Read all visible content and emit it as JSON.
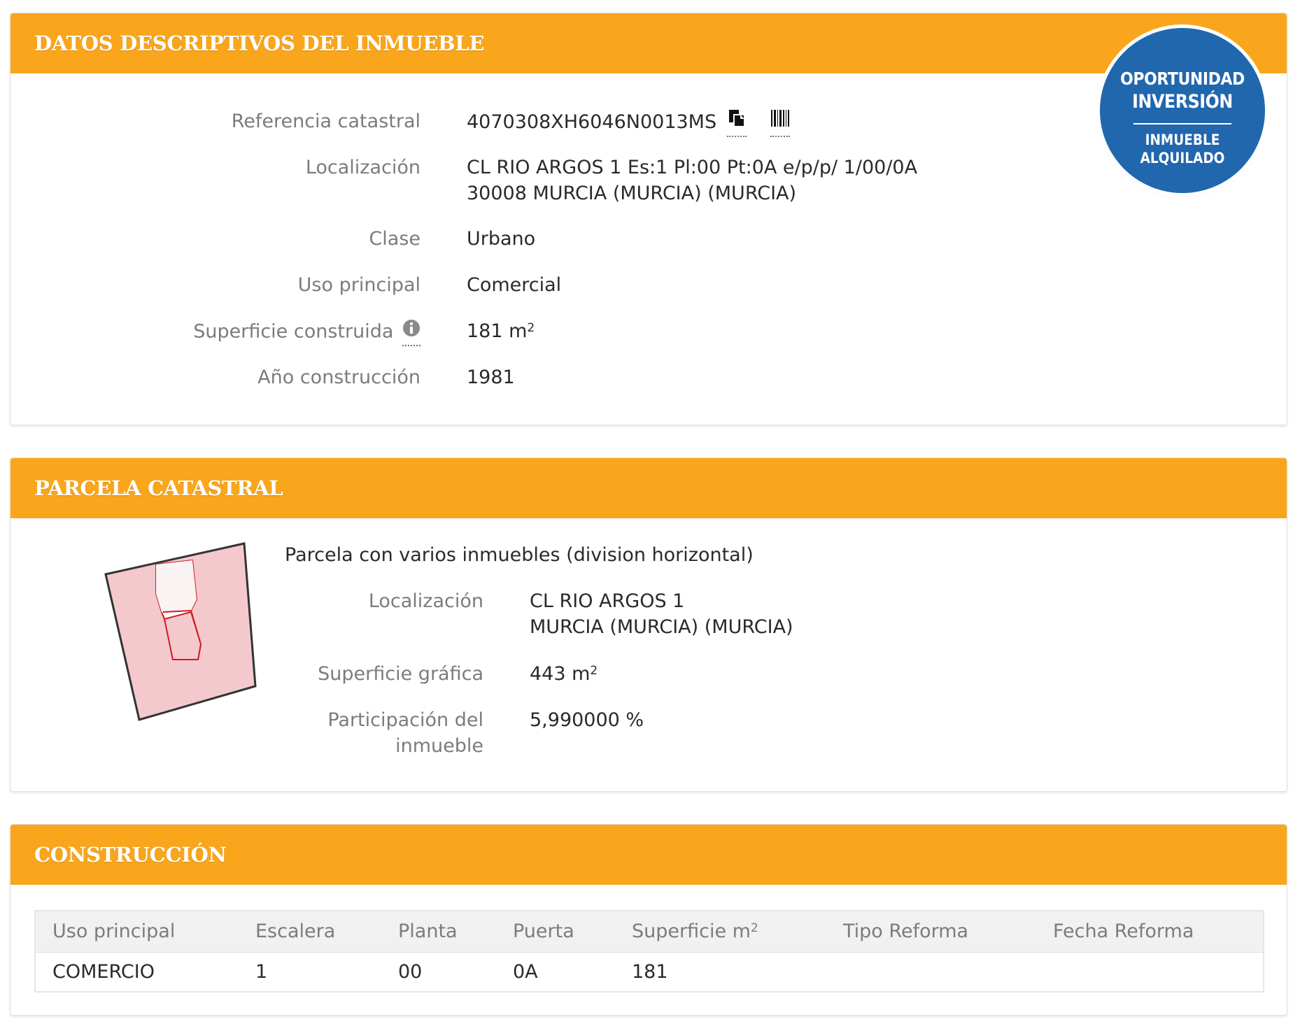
{
  "badge": {
    "line1": "OPORTUNIDAD",
    "line2": "INVERSIÓN",
    "line3": "INMUEBLE",
    "line4": "ALQUILADO",
    "color": "#2167ad"
  },
  "colors": {
    "header": "#f9a61c"
  },
  "datos": {
    "title": "DATOS DESCRIPTIVOS DEL INMUEBLE",
    "referencia_label": "Referencia catastral",
    "referencia_value": "4070308XH6046N0013MS",
    "localizacion_label": "Localización",
    "localizacion_line1": "CL RIO ARGOS 1 Es:1 Pl:00 Pt:0A e/p/p/ 1/00/0A",
    "localizacion_line2": "30008 MURCIA (MURCIA) (MURCIA)",
    "clase_label": "Clase",
    "clase_value": "Urbano",
    "uso_label": "Uso principal",
    "uso_value": "Comercial",
    "superficie_label": "Superficie construida",
    "superficie_value": "181 m",
    "superficie_unit_sup": "2",
    "anio_label": "Año construcción",
    "anio_value": "1981"
  },
  "parcela": {
    "title": "PARCELA CATASTRAL",
    "description": "Parcela con varios inmuebles (division horizontal)",
    "localizacion_label": "Localización",
    "localizacion_line1": "CL RIO ARGOS 1",
    "localizacion_line2": "MURCIA (MURCIA) (MURCIA)",
    "superficie_label": "Superficie gráfica",
    "superficie_value": "443 m",
    "superficie_unit_sup": "2",
    "participacion_label_line1": "Participación del",
    "participacion_label_line2": "inmueble",
    "participacion_value": "5,990000 %"
  },
  "construccion": {
    "title": "CONSTRUCCIÓN",
    "columns": {
      "uso": "Uso principal",
      "escalera": "Escalera",
      "planta": "Planta",
      "puerta": "Puerta",
      "superficie": "Superficie m",
      "superficie_sup": "2",
      "tipo_reforma": "Tipo Reforma",
      "fecha_reforma": "Fecha Reforma"
    },
    "rows": [
      {
        "uso": "COMERCIO",
        "escalera": "1",
        "planta": "00",
        "puerta": "0A",
        "superficie": "181",
        "tipo_reforma": "",
        "fecha_reforma": ""
      }
    ]
  }
}
